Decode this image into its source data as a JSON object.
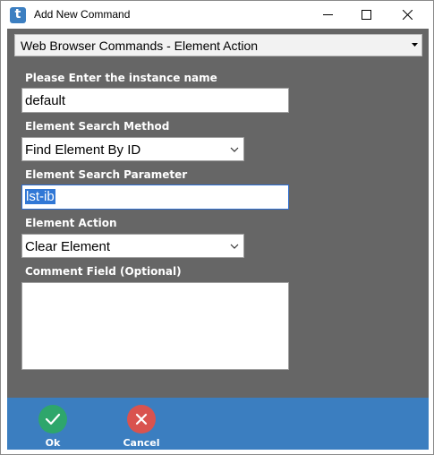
{
  "window": {
    "title": "Add New Command",
    "app_icon_letter": "t"
  },
  "command_select": {
    "value": "Web Browser Commands - Element Action"
  },
  "fields": {
    "instance_label": "Please Enter the instance name",
    "instance_value": "default",
    "search_method_label": "Element Search Method",
    "search_method_value": "Find Element By ID",
    "search_param_label": "Element Search Parameter",
    "search_param_value": "lst-ib",
    "action_label": "Element Action",
    "action_value": "Clear Element",
    "comment_label": "Comment Field (Optional)",
    "comment_value": ""
  },
  "footer": {
    "ok_label": "Ok",
    "cancel_label": "Cancel"
  },
  "colors": {
    "content_bg": "#666666",
    "footer_bg": "#3b7ec0",
    "ok_green": "#2ea66b",
    "cancel_red": "#d9534f",
    "selection_blue": "#3178d6"
  },
  "icons": {
    "app": "app-t-icon",
    "minimize": "minimize-icon",
    "maximize": "maximize-icon",
    "close": "close-icon",
    "dropdown": "chevron-down-icon",
    "ok": "checkmark-icon",
    "cancel": "x-icon"
  }
}
